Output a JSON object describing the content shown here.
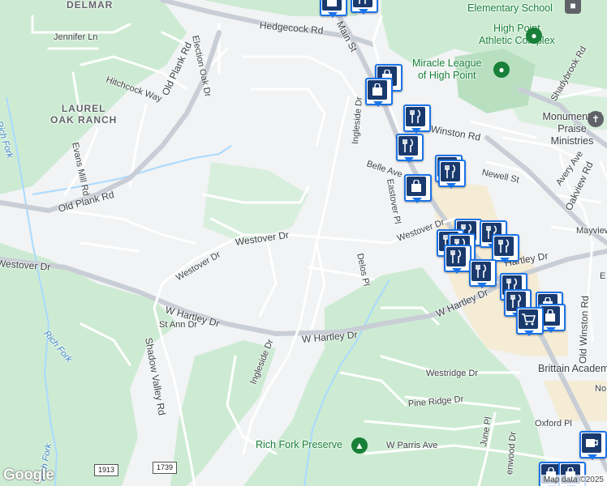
{
  "map": {
    "provider_logo": "Google",
    "attribution": "Map data ©2025",
    "colors": {
      "land": "#f1f3f4",
      "park": "#cdebd3",
      "park_dark": "#b8e0c0",
      "road": "#ffffff",
      "arterial": "#c9ced6",
      "water": "#aadaff",
      "commercial": "#f5ecd6"
    },
    "areas": [
      {
        "id": "delmar",
        "text": "DELMAR"
      },
      {
        "id": "laurel",
        "text": "LAUREL\nOAK RANCH"
      }
    ],
    "streets": [
      "Hedgecock Rd",
      "Main St",
      "Jennifer Ln",
      "Election Oak Dr",
      "Old Plank Rd",
      "Hitchcock Way",
      "Evans Mill Rd",
      "Old Plank Rd",
      "Westover Dr",
      "Westover Dr",
      "Westover Dr",
      "Westover Dr",
      "W Hartley Dr",
      "W Hartley Dr",
      "W Hartley Dr",
      "St Ann Dr",
      "Shadow Valley Rd",
      "Ingleside Dr",
      "Ingleside Dr",
      "Delos Pl",
      "Eastover Pl",
      "Belle Ave",
      "Newell St",
      "Avery Ave",
      "Oakview Rd",
      "Mayview",
      "Hartley Dr",
      "Old Winston Rd",
      "Westridge Dr",
      "Pine Ridge Dr",
      "Oxford Pl",
      "June Pl",
      "W Parris Ave",
      "Shadybrook Rd",
      "Winston Rd",
      "No",
      "E",
      "enwood Dr"
    ],
    "water_labels": [
      "Rich Fork",
      "Rich Fork",
      "Rich Fork"
    ],
    "pois": [
      {
        "id": "school",
        "text": "Elementary School",
        "icon": "school-icon"
      },
      {
        "id": "athletic",
        "text": "High Point\nAthletic Complex",
        "icon": "sports-icon"
      },
      {
        "id": "miracle",
        "text": "Miracle League\nof High Point",
        "icon": "sports-icon"
      },
      {
        "id": "monument",
        "text": "Monument of\nPraise Ministries",
        "icon": "church-icon"
      },
      {
        "id": "brittain",
        "text": "Brittain Academ",
        "icon": "school-icon"
      },
      {
        "id": "preserve",
        "text": "Rich Fork Preserve",
        "icon": "park-icon"
      }
    ],
    "shields": [
      "1913",
      "1739"
    ]
  }
}
